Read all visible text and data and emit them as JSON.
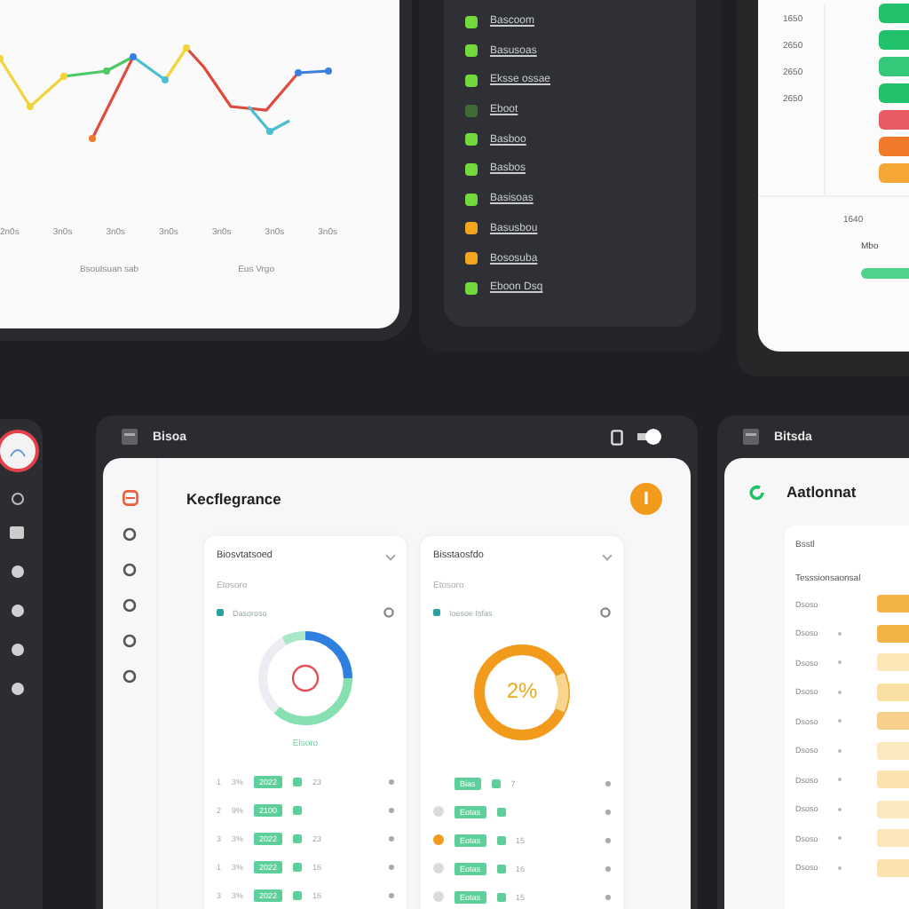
{
  "chart_panel": {
    "x_ticks": [
      "2n0s",
      "3n0s",
      "3n0s",
      "3n0s",
      "3n0s",
      "3n0s",
      "3n0s"
    ],
    "x_title": "Bsoutsuan sab",
    "legend": "Eus Vrgo"
  },
  "status_list": {
    "items": [
      {
        "label": "Bascoom",
        "color": "#72d83c"
      },
      {
        "label": "Basusoas",
        "color": "#72d83c"
      },
      {
        "label": "Eksse ossae",
        "color": "#72d83c"
      },
      {
        "label": "Eboot",
        "color": "#3f6b35"
      },
      {
        "label": "Basboo",
        "color": "#72d83c"
      },
      {
        "label": "Basbos",
        "color": "#72d83c"
      },
      {
        "label": "Basisoas",
        "color": "#72d83c"
      },
      {
        "label": "Basusbou",
        "color": "#f2a51f"
      },
      {
        "label": "Bososuba",
        "color": "#f2a51f"
      },
      {
        "label": "Eboon Dsq",
        "color": "#72d83c"
      }
    ]
  },
  "bar_panel": {
    "y_labels": [
      "1650",
      "2650",
      "2650",
      "2650"
    ],
    "bars": [
      {
        "color": "#22c16b"
      },
      {
        "color": "#22c16b"
      },
      {
        "color": "#34c97a"
      },
      {
        "color": "#22c16b"
      },
      {
        "color": "#ea5a62"
      },
      {
        "color": "#f07a2a"
      },
      {
        "color": "#f5a835"
      }
    ],
    "footer_value": "1640",
    "footer_label": "Mbo"
  },
  "main_window": {
    "title": "Bisoa",
    "heading": "Kecflegrance",
    "cards": [
      {
        "title": "Biosvtatsoed",
        "subtitle": "Etosoro",
        "legend": "Dasoroso",
        "caption": "Elsoro",
        "rows": [
          {
            "num": "1",
            "pct": "3%",
            "tag": "2022",
            "value": "23"
          },
          {
            "num": "2",
            "pct": "9%",
            "tag": "2100",
            "value": ""
          },
          {
            "num": "3",
            "pct": "3%",
            "tag": "2022",
            "value": "23"
          },
          {
            "num": "1",
            "pct": "3%",
            "tag": "2022",
            "value": "16"
          },
          {
            "num": "3",
            "pct": "3%",
            "tag": "2022",
            "value": "16"
          }
        ]
      },
      {
        "title": "Bisstaosfdo",
        "subtitle": "Etosoro",
        "legend": "Ioesoe Isfas",
        "center": "2%",
        "rows": [
          {
            "tag": "Bias",
            "value": "7"
          },
          {
            "tag": "Eotas",
            "value": "",
            "color": "#d9dadd"
          },
          {
            "tag": "Eotas",
            "value": "15",
            "color": "#f29a1b"
          },
          {
            "tag": "Eotas",
            "value": "16",
            "color": "#d9dadd"
          },
          {
            "tag": "Eotas",
            "value": "15",
            "color": "#d9dadd"
          }
        ]
      }
    ]
  },
  "right_window": {
    "title": "Bitsda",
    "heading": "Aatlonnat",
    "subhead": "Bsstl",
    "column": "Tesssionsaonsal",
    "rows": [
      {
        "label": "Dsoso",
        "dot": false,
        "color": "#f2b347"
      },
      {
        "label": "Dsoso",
        "dot": true,
        "color": "#f2b347"
      },
      {
        "label": "Dsoso",
        "dot": true,
        "color": "#fbe7b8"
      },
      {
        "label": "Dsoso",
        "dot": true,
        "color": "#f9dfa5"
      },
      {
        "label": "Dsoso",
        "dot": true,
        "color": "#f6d08a"
      },
      {
        "label": "Dsoso",
        "dot": true,
        "color": "#fbe9c0"
      },
      {
        "label": "Dsoso",
        "dot": true,
        "color": "#fae3b1"
      },
      {
        "label": "Dsoso",
        "dot": true,
        "color": "#fbe9c2"
      },
      {
        "label": "Dsoso",
        "dot": true,
        "color": "#fae6b8"
      },
      {
        "label": "Dsoso",
        "dot": true,
        "color": "#f9e2ad"
      }
    ]
  }
}
